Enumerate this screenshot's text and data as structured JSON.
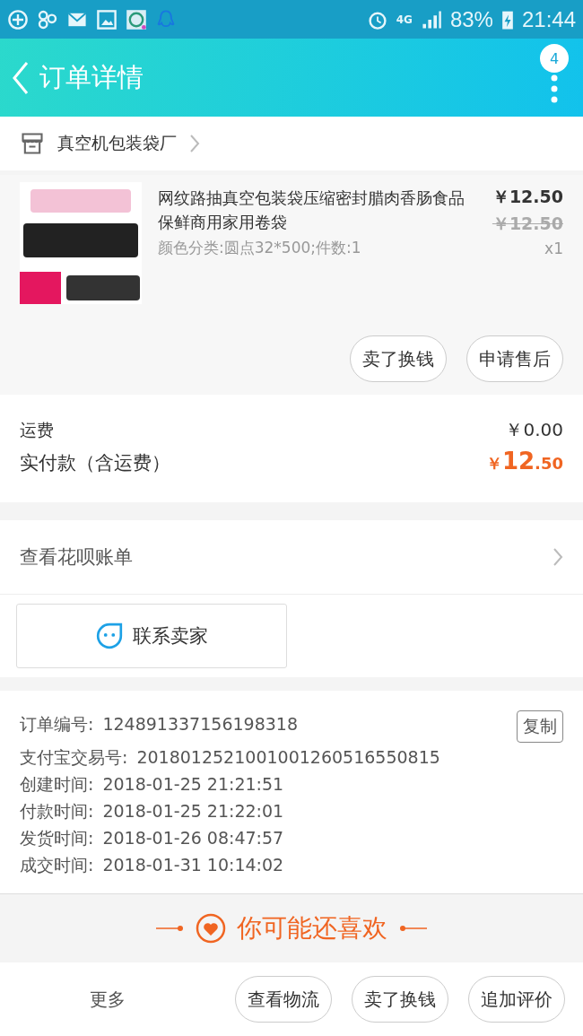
{
  "status_bar": {
    "network": "4G",
    "battery": "83%",
    "time": "21:44"
  },
  "header": {
    "title": "订单详情",
    "badge": "4"
  },
  "shop": {
    "name": "真空机包装袋厂"
  },
  "product": {
    "kind": "picture",
    "title": "网纹路抽真空包装袋压缩密封腊肉香肠食品保鲜商用家用卷袋",
    "sku": "颜色分类:圆点32*500;件数:1",
    "price": "￥12.50",
    "original_price": "￥12.50",
    "quantity": "x1",
    "actions": [
      "卖了换钱",
      "申请售后"
    ]
  },
  "fees": [
    {
      "label": "运费",
      "value": "￥0.00",
      "kind": "plain"
    },
    {
      "label": "实付款（含运费）",
      "currency": "￥",
      "main": "12",
      "decimals": ".50",
      "kind": "total"
    }
  ],
  "bill_link": "查看花呗账单",
  "contact_button": "联系卖家",
  "order_info": {
    "copy_button": "复制",
    "rows": [
      {
        "label": "订单编号:",
        "value": "124891337156198318"
      },
      {
        "label": "支付宝交易号:",
        "value": "2018012521001001260516550815"
      },
      {
        "label": "创建时间:",
        "value": "2018-01-25 21:21:51"
      },
      {
        "label": "付款时间:",
        "value": "2018-01-25 21:22:01"
      },
      {
        "label": "发货时间:",
        "value": "2018-01-26 08:47:57"
      },
      {
        "label": "成交时间:",
        "value": "2018-01-31 10:14:02"
      }
    ]
  },
  "recommend_title": "你可能还喜欢",
  "bottom_bar": {
    "more": "更多",
    "buttons": [
      "查看物流",
      "卖了换钱",
      "追加评价"
    ]
  }
}
